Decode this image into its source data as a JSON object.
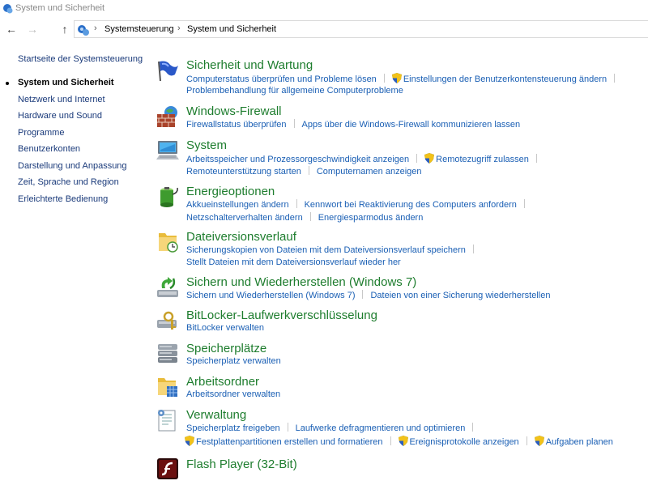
{
  "window": {
    "title": "System und Sicherheit"
  },
  "nav": {
    "back": "←",
    "forward": "→",
    "up": "↑"
  },
  "breadcrumb": {
    "sep": "›",
    "items": [
      "Systemsteuerung",
      "System und Sicherheit"
    ]
  },
  "sidebar": {
    "items": [
      "Startseite der Systemsteuerung",
      "System und Sicherheit",
      "Netzwerk und Internet",
      "Hardware und Sound",
      "Programme",
      "Benutzerkonten",
      "Darstellung und Anpassung",
      "Zeit, Sprache und Region",
      "Erleichterte Bedienung"
    ]
  },
  "categories": {
    "sicherheit": {
      "title": "Sicherheit und Wartung",
      "l1": "Computerstatus überprüfen und Probleme lösen",
      "l2": "Einstellungen der Benutzerkontensteuerung ändern",
      "l3": "Problembehandlung für allgemeine Computerprobleme"
    },
    "firewall": {
      "title": "Windows-Firewall",
      "l1": "Firewallstatus überprüfen",
      "l2": "Apps über die Windows-Firewall kommunizieren lassen"
    },
    "system": {
      "title": "System",
      "l1": "Arbeitsspeicher und Prozessorgeschwindigkeit anzeigen",
      "l2": "Remotezugriff zulassen",
      "l3": "Remoteunterstützung starten",
      "l4": "Computernamen anzeigen"
    },
    "energie": {
      "title": "Energieoptionen",
      "l1": "Akkueinstellungen ändern",
      "l2": "Kennwort bei Reaktivierung des Computers anfordern",
      "l3": "Netzschalterverhalten ändern",
      "l4": "Energiesparmodus ändern"
    },
    "dateiversion": {
      "title": "Dateiversionsverlauf",
      "l1": "Sicherungskopien von Dateien mit dem Dateiversionsverlauf speichern",
      "l2": "Stellt Dateien mit dem Dateiversionsverlauf wieder her"
    },
    "sichern": {
      "title": "Sichern und Wiederherstellen (Windows 7)",
      "l1": "Sichern und Wiederherstellen (Windows 7)",
      "l2": "Dateien von einer Sicherung wiederherstellen"
    },
    "bitlocker": {
      "title": "BitLocker-Laufwerkverschlüsselung",
      "l1": "BitLocker verwalten"
    },
    "speicher": {
      "title": "Speicherplätze",
      "l1": "Speicherplatz verwalten"
    },
    "arbeitsordner": {
      "title": "Arbeitsordner",
      "l1": "Arbeitsordner verwalten"
    },
    "verwaltung": {
      "title": "Verwaltung",
      "l1": "Speicherplatz freigeben",
      "l2": "Laufwerke defragmentieren und optimieren",
      "l3": "Festplattenpartitionen erstellen und formatieren",
      "l4": "Ereignisprotokolle anzeigen",
      "l5": "Aufgaben planen"
    },
    "flash": {
      "title": "Flash Player (32-Bit)"
    }
  },
  "colors": {
    "category_title": "#1e7d2e",
    "link": "#1a5fb4",
    "sidebar_link": "#1a3a7a"
  }
}
